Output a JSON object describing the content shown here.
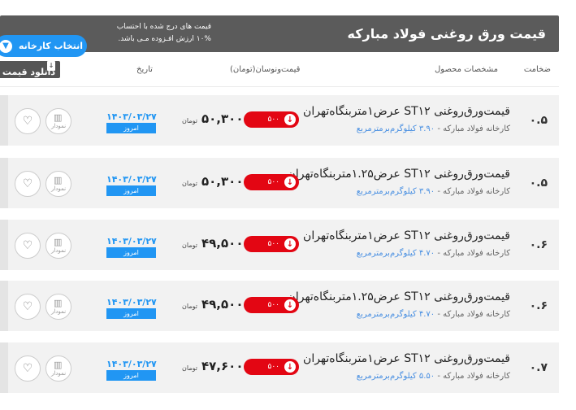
{
  "topbar": {
    "title": "قیمت ورق روغنی فولاد مبارکه",
    "note_line1": "قیمت های درج شده با احتساب",
    "note_line2": "۱۰% ارزش افـزوده مـی باشد.",
    "factory_button": "انتخاب کارخانه",
    "chevron_icon": "chevron-down"
  },
  "columns": {
    "thickness": "ضخامت",
    "specs": "مشخصات محصول",
    "price": "قیمت‌ونوسان(تومان)",
    "date": "تاریخ",
    "download": "دانلود قیمت"
  },
  "rows": [
    {
      "thickness": "۰.۵",
      "name": "قیمت‌ورق‌روغنی ST۱۲ عرض۱متربنگاه‌تهران",
      "factory": "کارخانه فولاد مبارکه",
      "weight": "۳.۹۰ کیلوگرم‌برمترمربع",
      "change": "۵۰۰",
      "price": "۵۰,۳۰۰",
      "unit": "تومان",
      "date": "۱۴۰۳/۰۳/۲۷",
      "today": "امروز",
      "chart": "نمودار"
    },
    {
      "thickness": "۰.۵",
      "name": "قیمت‌ورق‌روغنی ST۱۲ عرض۱.۲۵متربنگاه‌تهران",
      "factory": "کارخانه فولاد مبارکه",
      "weight": "۳.۹۰ کیلوگرم‌برمترمربع",
      "change": "۵۰۰",
      "price": "۵۰,۳۰۰",
      "unit": "تومان",
      "date": "۱۴۰۳/۰۳/۲۷",
      "today": "امروز",
      "chart": "نمودار"
    },
    {
      "thickness": "۰.۶",
      "name": "قیمت‌ورق‌روغنی ST۱۲ عرض۱متربنگاه‌تهران",
      "factory": "کارخانه فولاد مبارکه",
      "weight": "۴.۷۰ کیلوگرم‌برمترمربع",
      "change": "۵۰۰",
      "price": "۴۹,۵۰۰",
      "unit": "تومان",
      "date": "۱۴۰۳/۰۳/۲۷",
      "today": "امروز",
      "chart": "نمودار"
    },
    {
      "thickness": "۰.۶",
      "name": "قیمت‌ورق‌روغنی ST۱۲ عرض۱.۲۵متربنگاه‌تهران",
      "factory": "کارخانه فولاد مبارکه",
      "weight": "۴.۷۰ کیلوگرم‌برمترمربع",
      "change": "۵۰۰",
      "price": "۴۹,۵۰۰",
      "unit": "تومان",
      "date": "۱۴۰۳/۰۳/۲۷",
      "today": "امروز",
      "chart": "نمودار"
    },
    {
      "thickness": "۰.۷",
      "name": "قیمت‌ورق‌روغنی ST۱۲ عرض۱متربنگاه‌تهران",
      "factory": "کارخانه فولاد مبارکه",
      "weight": "۵.۵۰ کیلوگرم‌برمترمربع",
      "change": "۵۰۰",
      "price": "۴۷,۶۰۰",
      "unit": "تومان",
      "date": "۱۴۰۳/۰۳/۲۷",
      "today": "امروز",
      "chart": "نمودار"
    }
  ],
  "colors": {
    "accent": "#2196f3",
    "down": "#e30613",
    "bar": "#5b5b5b"
  }
}
